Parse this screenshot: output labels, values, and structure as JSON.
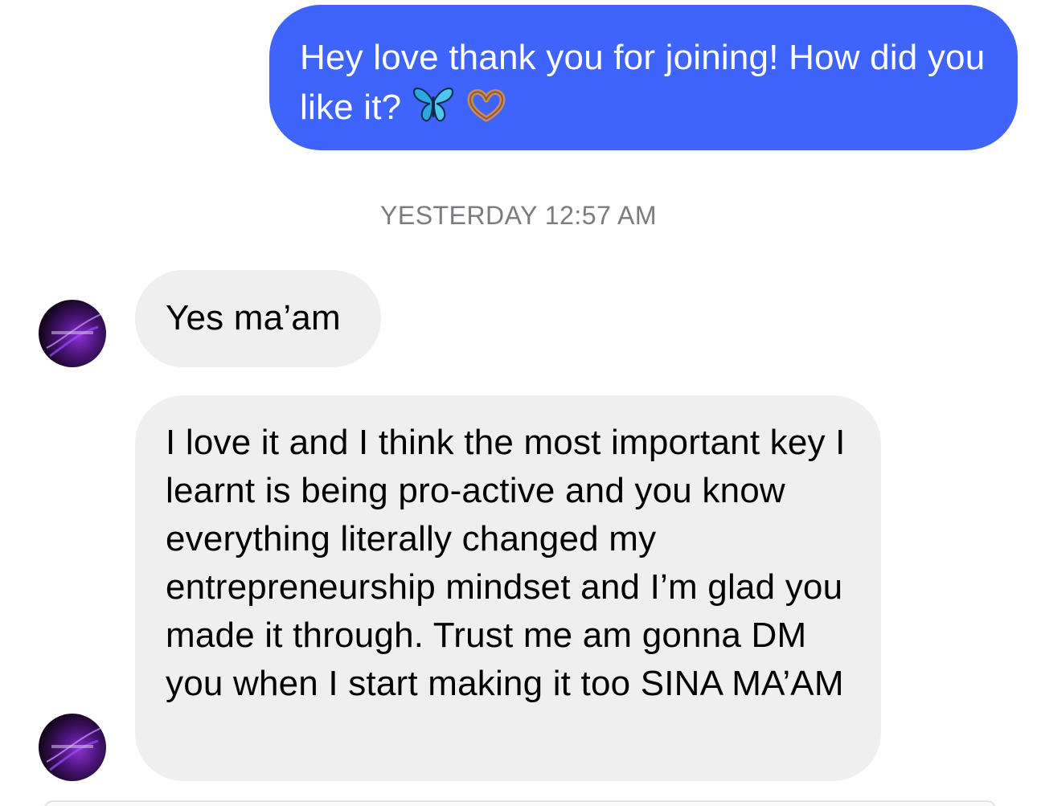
{
  "messages": [
    {
      "direction": "outgoing",
      "text": "Hey love thank you for joining! How did you like it?",
      "emojis": [
        "butterfly-emoji",
        "heart-hands-emoji"
      ]
    },
    {
      "direction": "incoming",
      "text": "Yes ma’am"
    },
    {
      "direction": "incoming",
      "text": "I love it and I think the most important key I learnt is being pro-active and you know everything literally changed my entrepreneurship mindset and I’m glad you made it through. Trust me am gonna DM you when I start making it too SINA MA’AM"
    }
  ],
  "timestamp": "YESTERDAY 12:57 AM",
  "colors": {
    "outgoing_bubble": "#3f64fb",
    "incoming_bubble": "#efefef",
    "timestamp_text": "#7b7b80"
  }
}
